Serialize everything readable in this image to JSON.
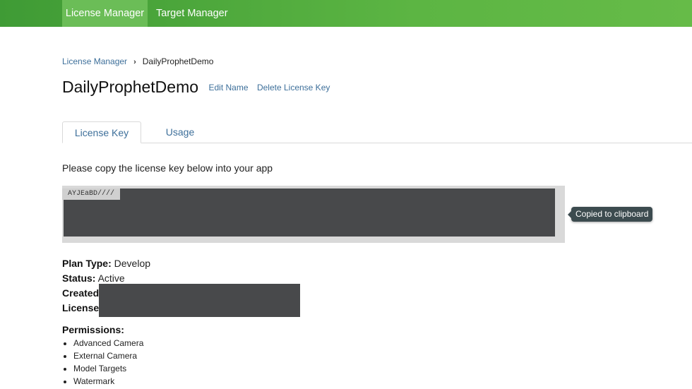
{
  "nav": {
    "items": [
      {
        "label": "License Manager",
        "active": true
      },
      {
        "label": "Target Manager",
        "active": false
      }
    ],
    "accent": "#5cb543"
  },
  "breadcrumb": {
    "parent": "License Manager",
    "separator": "›",
    "current": "DailyProphetDemo"
  },
  "header": {
    "title": "DailyProphetDemo",
    "edit_name": "Edit Name",
    "delete_key": "Delete License Key"
  },
  "tabs": [
    {
      "label": "License Key",
      "active": true
    },
    {
      "label": "Usage",
      "active": false
    }
  ],
  "instruction": "Please copy the license key below into your app",
  "license_key": {
    "visible_prefix": "AYJEaBD////"
  },
  "tooltip": "Copied to clipboard",
  "details": {
    "plan_label": "Plan Type:",
    "plan_value": "Develop",
    "status_label": "Status:",
    "status_value": "Active",
    "created_label": "Created:",
    "license_label": "License"
  },
  "permissions": {
    "title": "Permissions:",
    "items": [
      "Advanced Camera",
      "External Camera",
      "Model Targets",
      "Watermark"
    ]
  }
}
